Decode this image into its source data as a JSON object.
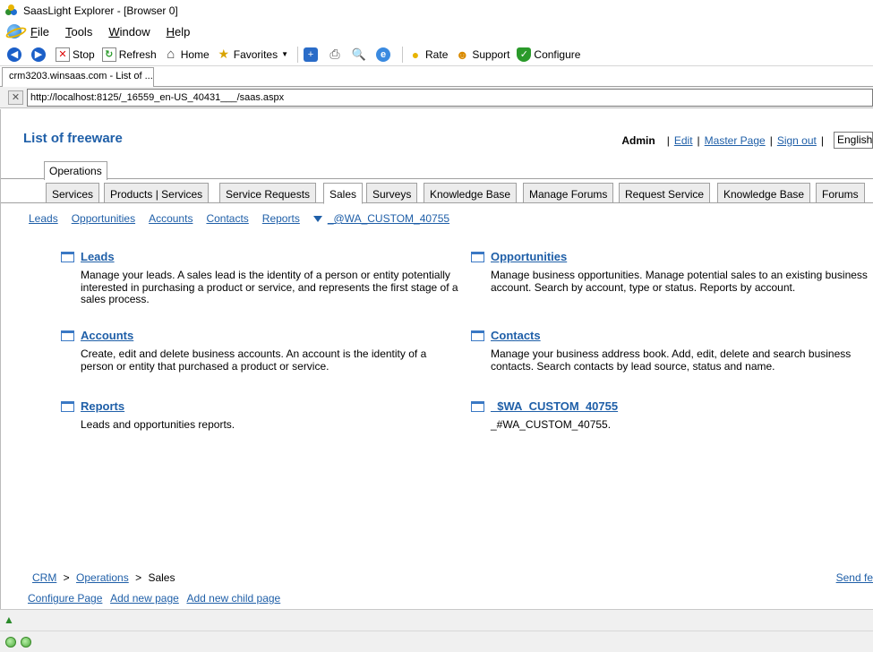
{
  "window": {
    "title": "SaasLight Explorer - [Browser 0]"
  },
  "menu": [
    {
      "label": "File",
      "accel": "F",
      "rest": "ile"
    },
    {
      "label": "Tools",
      "accel": "T",
      "rest": "ools"
    },
    {
      "label": "Window",
      "accel": "W",
      "rest": "indow"
    },
    {
      "label": "Help",
      "accel": "H",
      "rest": "elp"
    }
  ],
  "toolbar": {
    "stop": "Stop",
    "refresh": "Refresh",
    "home": "Home",
    "favorites": "Favorites",
    "rate": "Rate",
    "support": "Support",
    "configure": "Configure"
  },
  "browser_tab": {
    "label": "crm3203.winsaas.com - List of ..."
  },
  "address": {
    "url": "http://localhost:8125/_16559_en-US_40431___/saas.aspx"
  },
  "page": {
    "title": "List of freeware",
    "user": {
      "name": "Admin",
      "edit": "Edit",
      "master_page": "Master Page",
      "sign_out": "Sign out",
      "language": "English"
    },
    "top_tab": "Operations",
    "tabs": [
      "Services",
      "Products | Services",
      "Service Requests",
      "Sales",
      "Surveys",
      "Knowledge Base",
      "Manage Forums",
      "Request Service",
      "Knowledge Base",
      "Forums"
    ],
    "active_tab": "Sales",
    "subnav": [
      "Leads",
      "Opportunities",
      "Accounts",
      "Contacts",
      "Reports"
    ],
    "subnav_custom": "_@WA_CUSTOM_40755",
    "cards": [
      {
        "title": "Leads",
        "desc": "Manage your leads. A sales lead is the identity of a person or entity potentially interested in purchasing a product or service, and represents the first stage of a sales process."
      },
      {
        "title": "Opportunities",
        "desc": "Manage business opportunities. Manage potential sales to an existing business account. Search by account, type or status. Reports by account."
      },
      {
        "title": "Accounts",
        "desc": "Create, edit and delete business accounts. An account is the identity of a person or entity that purchased a product or service."
      },
      {
        "title": "Contacts",
        "desc": "Manage your business address book. Add, edit, delete and search business contacts. Search contacts by lead source, status and name."
      },
      {
        "title": "Reports",
        "desc": "Leads and opportunities reports."
      },
      {
        "title": "_$WA_CUSTOM_40755",
        "desc": "_#WA_CUSTOM_40755."
      }
    ],
    "breadcrumb": {
      "crm": "CRM",
      "operations": "Operations",
      "current": "Sales"
    },
    "send_link": "Send fe",
    "footer": {
      "configure_page": "Configure Page",
      "add_new_page": "Add new page",
      "add_new_child_page": "Add new child page"
    }
  },
  "colors": {
    "link": "#1f5fa8",
    "tab_inactive": "#ececec",
    "status_dot": "#4aa83a"
  }
}
